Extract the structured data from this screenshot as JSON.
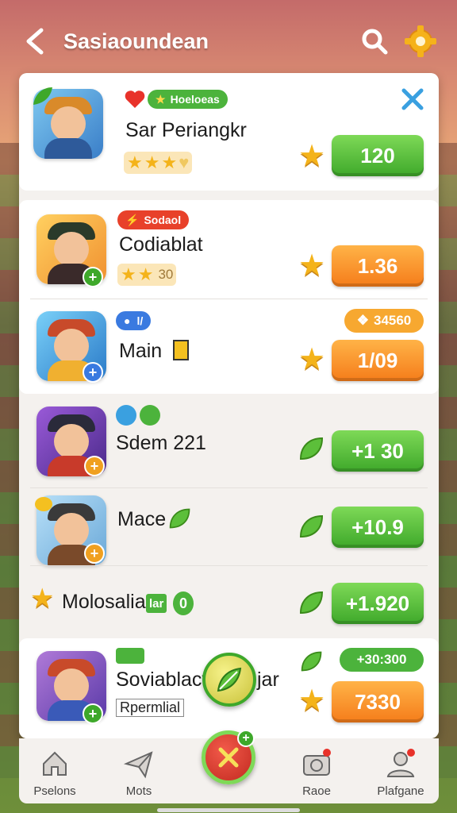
{
  "header": {
    "title": "Sasiaoundean"
  },
  "featured": {
    "tag": "Hoeloeas",
    "name": "Sar Periangkr",
    "price": "120"
  },
  "items": [
    {
      "tag": "Sodaol",
      "name": "Codiablat",
      "stars_num": "30",
      "price": "1.36",
      "color": "orange"
    },
    {
      "tag": "l/",
      "name": "Main",
      "badge": "34560",
      "price": "1/09",
      "color": "orange"
    },
    {
      "name": "Sdem 221",
      "price": "+1 30",
      "color": "green"
    },
    {
      "name": "Mace",
      "price": "+10.9",
      "color": "green"
    },
    {
      "name": "Molosalia",
      "mini_tag": "lar",
      "mini_num": "0",
      "price": "+1.920",
      "color": "green"
    },
    {
      "name": "Soviablact",
      "name_tail": "jar",
      "sub": "Rpermlial",
      "pill_top": "+30:300",
      "price": "7330",
      "color": "orange"
    }
  ],
  "nav": [
    {
      "label": "Pselons",
      "icon": "home-icon"
    },
    {
      "label": "Mots",
      "icon": "paper-plane-icon"
    },
    {
      "label": "Raoe",
      "icon": "camera-icon"
    },
    {
      "label": "Plafgane",
      "icon": "profile-icon"
    }
  ],
  "colors": {
    "green": "#3ea82a",
    "orange": "#f57c1a",
    "star": "#f4b31a"
  }
}
